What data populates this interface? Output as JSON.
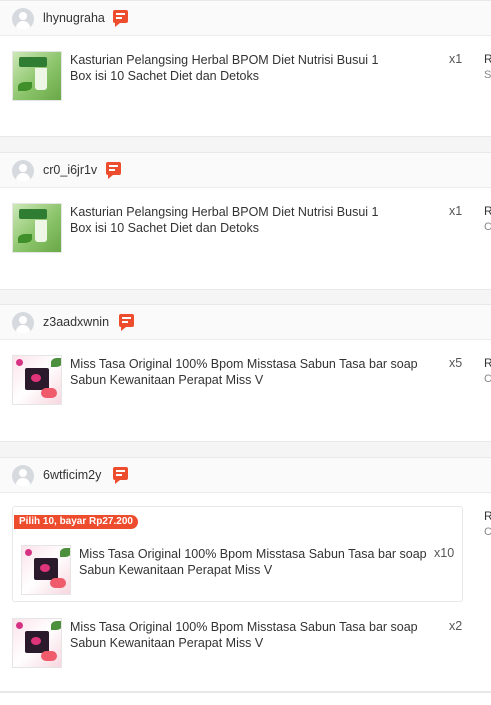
{
  "orders": [
    {
      "username": "lhynugraha",
      "items": [
        {
          "name": "Kasturian Pelangsing Herbal BPOM Diet Nutrisi Busui 1 Box isi 10 Sachet Diet dan Detoks",
          "qty": "x1",
          "thumb_text": "MINUMAN KASTURIAN"
        }
      ],
      "right_top": "R",
      "right_sub": "S"
    },
    {
      "username": "cr0_i6jr1v",
      "items": [
        {
          "name": "Kasturian Pelangsing Herbal BPOM Diet Nutrisi Busui 1 Box isi 10 Sachet Diet dan Detoks",
          "qty": "x1"
        }
      ],
      "right_top": "R",
      "right_sub": "C"
    },
    {
      "username": "z3aadxwnin",
      "items": [
        {
          "name": "Miss Tasa Original 100% Bpom Misstasa Sabun Tasa bar soap Sabun Kewanitaan Perapat Miss V",
          "qty": "x5"
        }
      ],
      "right_top": "R",
      "right_sub": "C"
    },
    {
      "username": "6wtficim2y",
      "bundle_badge": "Pilih 10, bayar Rp27.200",
      "bundle_item": {
        "name": "Miss Tasa Original 100% Bpom Misstasa Sabun Tasa bar soap Sabun Kewanitaan Perapat Miss V",
        "qty": "x10"
      },
      "items": [
        {
          "name": "Miss Tasa Original 100% Bpom Misstasa Sabun Tasa bar soap Sabun Kewanitaan Perapat Miss V",
          "qty": "x2"
        }
      ],
      "right_top": "R",
      "right_sub": "C"
    }
  ],
  "icons": {
    "avatar": "user-avatar-icon",
    "chat": "chat-icon"
  },
  "colors": {
    "accent": "#ee4d2d",
    "background": "#f5f5f5"
  }
}
